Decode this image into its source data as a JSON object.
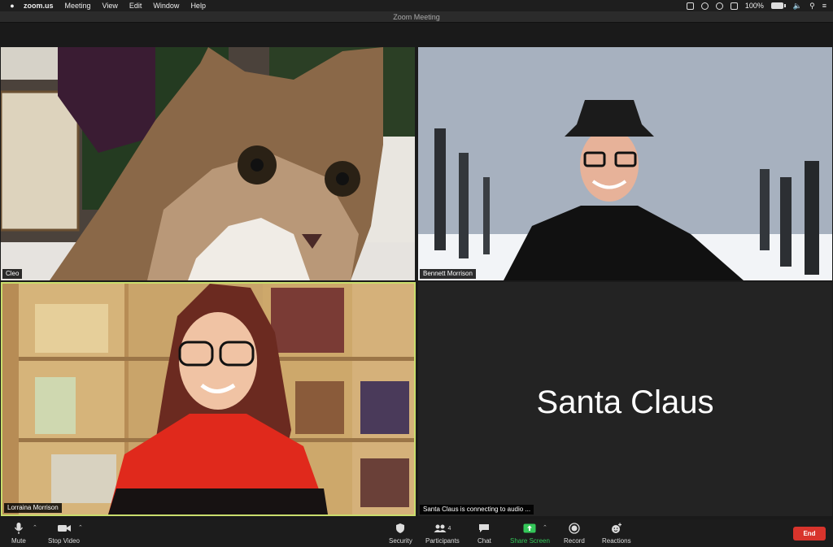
{
  "menubar": {
    "app": "zoom.us",
    "items": [
      "Meeting",
      "View",
      "Edit",
      "Window",
      "Help"
    ],
    "battery": "100%"
  },
  "window": {
    "title": "Zoom Meeting"
  },
  "tiles": {
    "cleo": {
      "name": "Cleo"
    },
    "bennett": {
      "name": "Bennett Morrison"
    },
    "lorraina": {
      "name": "Lorraina Morrison",
      "active_speaker": true
    },
    "santa": {
      "name": "Santa Claus",
      "status": "Santa Claus is connecting to audio ..."
    }
  },
  "toolbar": {
    "mute": "Mute",
    "stop_video": "Stop Video",
    "security": "Security",
    "participants": "Participants",
    "participants_count": "4",
    "chat": "Chat",
    "share_screen": "Share Screen",
    "record": "Record",
    "reactions": "Reactions",
    "end": "End"
  },
  "colors": {
    "accent_green": "#34c759",
    "end_red": "#d8342c",
    "speaker_border": "#c9dd6c"
  }
}
